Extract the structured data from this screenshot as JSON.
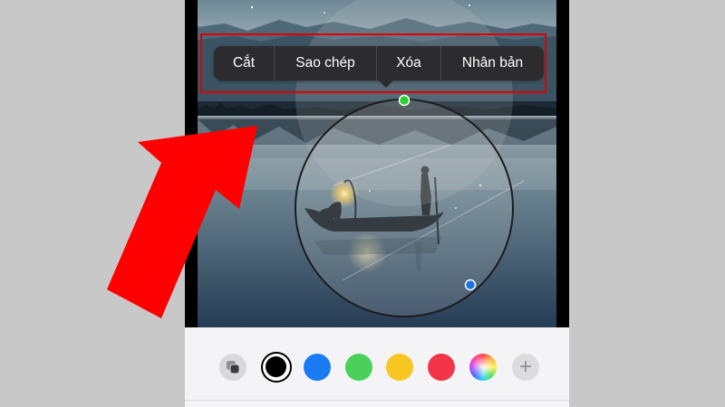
{
  "context_menu": {
    "items": [
      {
        "label": "Cắt"
      },
      {
        "label": "Sao chép"
      },
      {
        "label": "Xóa"
      },
      {
        "label": "Nhân bản"
      }
    ]
  },
  "toolbar": {
    "colors": [
      {
        "name": "black",
        "hex": "#000000",
        "selected": true
      },
      {
        "name": "blue",
        "hex": "#1a7cf5",
        "selected": false
      },
      {
        "name": "green",
        "hex": "#4cd05c",
        "selected": false
      },
      {
        "name": "yellow",
        "hex": "#f8c623",
        "selected": false
      },
      {
        "name": "red",
        "hex": "#f23548",
        "selected": false
      }
    ],
    "add_symbol": "+"
  },
  "colors": {
    "annotation_red": "#ff0000",
    "selection_handle_start": "#2bd12b",
    "selection_handle_end": "#1a74e0"
  }
}
